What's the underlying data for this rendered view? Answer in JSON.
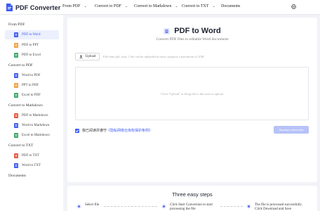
{
  "header": {
    "logo_text": "PDF Converter",
    "nav": [
      {
        "label": "From PDF",
        "has_dropdown": true
      },
      {
        "label": "Convert to PDF",
        "has_dropdown": true
      },
      {
        "label": "Convert to Markdown",
        "has_dropdown": true
      },
      {
        "label": "Convert to TXT",
        "has_dropdown": true
      },
      {
        "label": "Documents",
        "has_dropdown": false
      }
    ],
    "globe_icon": "globe-icon"
  },
  "sidebar": {
    "groups": [
      {
        "title": "From PDF",
        "items": [
          {
            "label": "PDF to Word",
            "icon": "word-file-icon",
            "active": true
          },
          {
            "label": "PDF to PPT",
            "icon": "ppt-file-icon",
            "active": false
          },
          {
            "label": "PDF to Excel",
            "icon": "excel-file-icon",
            "active": false
          }
        ]
      },
      {
        "title": "Convert to PDF",
        "items": [
          {
            "label": "Word to PDF",
            "icon": "word-file-icon"
          },
          {
            "label": "PPT to PDF",
            "icon": "ppt-file-icon"
          },
          {
            "label": "Excel to PDF",
            "icon": "excel-file-icon"
          }
        ]
      },
      {
        "title": "Convert to Markdown",
        "items": [
          {
            "label": "PDF to Markdown",
            "icon": "pdf-file-icon"
          },
          {
            "label": "Word to Markdown",
            "icon": "word-file-icon"
          },
          {
            "label": "Excel to Markdown",
            "icon": "excel-file-icon"
          }
        ]
      },
      {
        "title": "Convert to TXT",
        "items": [
          {
            "label": "PDF to TXT",
            "icon": "pdf-file-icon"
          },
          {
            "label": "Word to TXT",
            "icon": "word-file-icon"
          }
        ]
      }
    ],
    "documents_label": "Documents"
  },
  "main": {
    "title": "PDF to Word",
    "subtitle": "Convert PDF files to editable Word documents",
    "upload_label": "Upload",
    "upload_hint": "File limit pdf, only 1 file can be uploaded at most, supports a maximum of 10M",
    "dropzone_text": "Click \"Upload\" or Drag file to this area to upload",
    "agree_text": "我已阅读并遵守",
    "agree_link": "《隐私网络仓库权保护条例》",
    "agree_checked": true,
    "start_label": "Starting conversion"
  },
  "steps": {
    "title": "Three easy steps",
    "items": [
      {
        "text": "Select file"
      },
      {
        "text": "Click Start Conversion to start processing the file"
      },
      {
        "text": "The file is processed successfully. Click Download and Save"
      }
    ]
  },
  "colors": {
    "accent": "#3d5bf5",
    "accent_disabled": "#b7c2f8",
    "active_bg": "#eceffd",
    "page_bg": "#f2f3f7"
  }
}
